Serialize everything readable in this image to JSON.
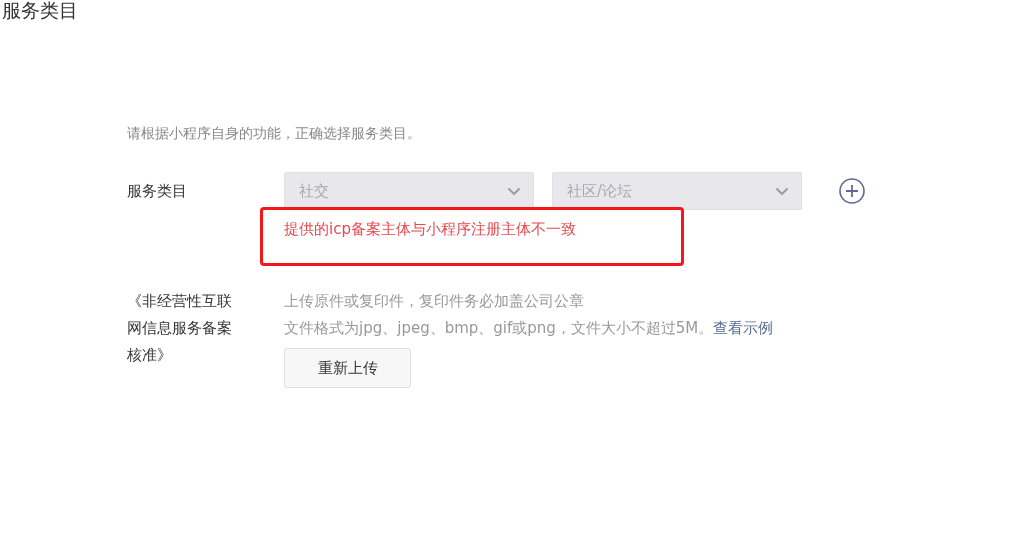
{
  "page_heading": "服务类目",
  "intro": "请根据小程序自身的功能，正确选择服务类目。",
  "category": {
    "label": "服务类目",
    "selects": [
      {
        "value": "社交",
        "disabled": true
      },
      {
        "value": "社区/论坛",
        "disabled": true
      }
    ],
    "error": "提供的icp备案主体与小程序注册主体不一致"
  },
  "upload": {
    "label": "《非经营性互联网信息服务备案核准》",
    "hint": "上传原件或复印件，复印件务必加盖公司公章",
    "format": "文件格式为jpg、jpeg、bmp、gif或png，文件大小不超过5M。",
    "example_link": "查看示例",
    "button": "重新上传"
  }
}
